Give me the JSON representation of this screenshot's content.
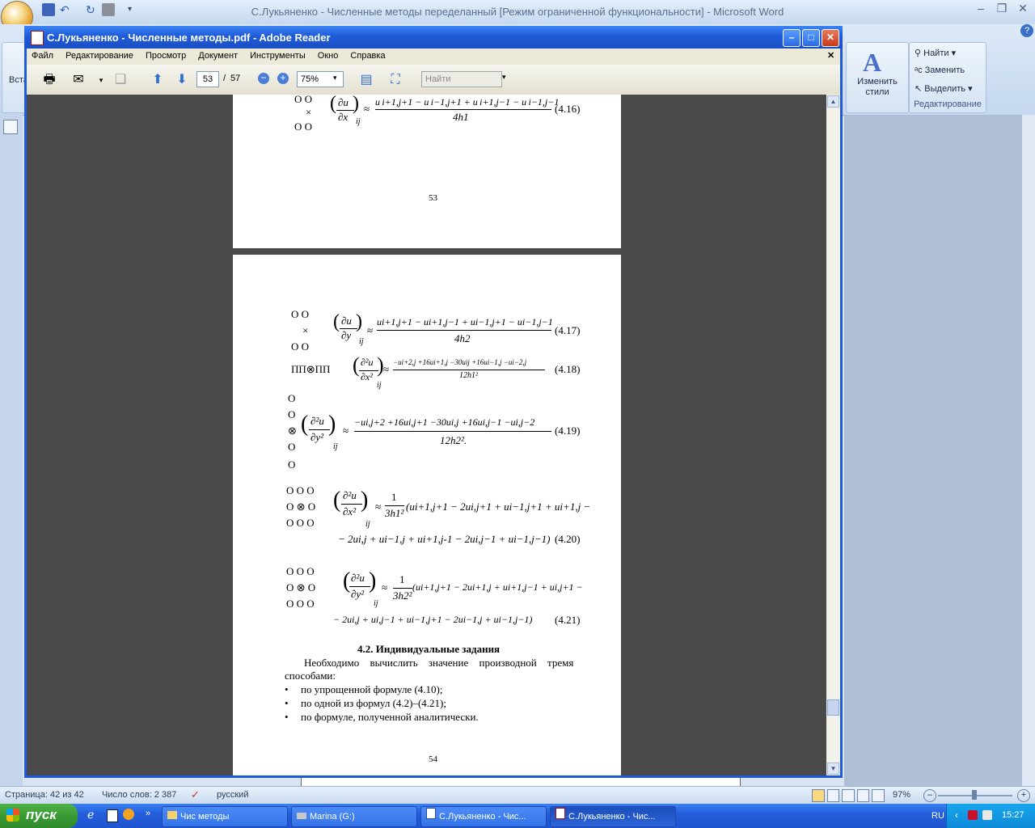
{
  "word": {
    "title": "С.Лукьяненко - Численные методы переделанный [Режим ограниченной функциональности] - Microsoft Word",
    "ribbon": {
      "paste_partial": "Вста",
      "find": "Найти",
      "replace": "Заменить",
      "select": "Выделить",
      "change_styles_line1": "Изменить",
      "change_styles_line2": "стили",
      "editing_group": "Редактирование"
    },
    "status": {
      "page": "Страница: 42 из 42",
      "words": "Число слов: 2 387",
      "language": "русский",
      "zoom": "97%"
    }
  },
  "reader": {
    "title": "С.Лукьяненко - Численные методы.pdf - Adobe Reader",
    "menu": [
      "Файл",
      "Редактирование",
      "Просмотр",
      "Документ",
      "Инструменты",
      "Окно",
      "Справка"
    ],
    "toolbar": {
      "page_current": "53",
      "page_sep": "/",
      "page_total": "57",
      "zoom": "75%",
      "search_placeholder": "Найти"
    }
  },
  "pdf": {
    "page53": {
      "page_number": "53",
      "eq416": {
        "stencil_top": "O   O",
        "stencil_mid": "×",
        "stencil_bot": "O   O",
        "lhs_num": "∂u",
        "lhs_den": "∂x",
        "sub": "ij",
        "approx": "≈",
        "numerator": "u i+1,j+1 − u i−1,j+1 + u i+1,j−1 − u i−1,j−1",
        "denominator": "4h1",
        "label": "(4.16)"
      }
    },
    "page54": {
      "page_number": "54",
      "eq417": {
        "stencil_top": "O   O",
        "stencil_mid": "×",
        "stencil_bot": "O   O",
        "lhs_num": "∂u",
        "lhs_den": "∂y",
        "sub": "ij",
        "approx": "≈",
        "numerator": "ui+1,j+1 − ui+1,j−1 + ui−1,j+1 − ui−1,j−1",
        "denominator": "4h2",
        "label": "(4.17)"
      },
      "eq418": {
        "stencil": "ПП⊗ПП",
        "lhs_num": "∂²u",
        "lhs_den": "∂x²",
        "sub": "ij",
        "approx": "≈",
        "numerator": "−ui+2,j +16ui+1,j −30uij +16ui−1,j −ui−2,j",
        "denominator": "12h1²",
        "label": "(4.18)"
      },
      "eq419": {
        "stencil_col": [
          "O",
          "O",
          "⊗",
          "O",
          "O"
        ],
        "lhs_num": "∂²u",
        "lhs_den": "∂y²",
        "sub": "ij",
        "approx": "≈",
        "numerator": "−ui,j+2 +16ui,j+1 −30ui,j +16ui,j−1 −ui,j−2",
        "denominator": "12h2².",
        "label": "(4.19)"
      },
      "eq420": {
        "stencil_rows": [
          "O O O",
          "O ⊗ O",
          "O O O"
        ],
        "lhs_num": "∂²u",
        "lhs_den": "∂x²",
        "sub": "ij",
        "approx": "≈",
        "coef_num": "1",
        "coef_den": "3h1²",
        "line1": "(ui+1,j+1 − 2ui,j+1 + ui−1,j+1 + ui+1,j −",
        "line2": "− 2ui,j + ui−1,j + ui+1,j-1 − 2ui,j−1 + ui−1,j−1)",
        "label": "(4.20)"
      },
      "eq421": {
        "stencil_rows": [
          "O O O",
          "O ⊗ O",
          "O O O"
        ],
        "lhs_num": "∂²u",
        "lhs_den": "∂y²",
        "sub": "ij",
        "approx": "≈",
        "coef_num": "1",
        "coef_den": "3h2²",
        "line1": "(ui+1,j+1 − 2ui+1,j + ui+1,j−1 + ui,j+1 −",
        "line2": "− 2ui,j + ui,j−1 + ui−1,j+1 − 2ui−1,j + ui−1,j−1)",
        "label": "(4.21)"
      },
      "section_title": "4.2. Индивидуальные задания",
      "intro": "Необходимо вычислить значение производной тремя",
      "intro2": "способами:",
      "bullets": [
        "по упрощенной формуле  (4.10);",
        "по одной из формул  (4.2)–(4.21);",
        "по формуле, полученной аналитически."
      ]
    }
  },
  "taskbar": {
    "start": "пуск",
    "tasks": [
      "Чис методы",
      "Marina (G:)",
      "С.Лукьяненко - Чис...",
      "С.Лукьяненко - Чис..."
    ],
    "lang": "RU",
    "clock": "15:27"
  }
}
